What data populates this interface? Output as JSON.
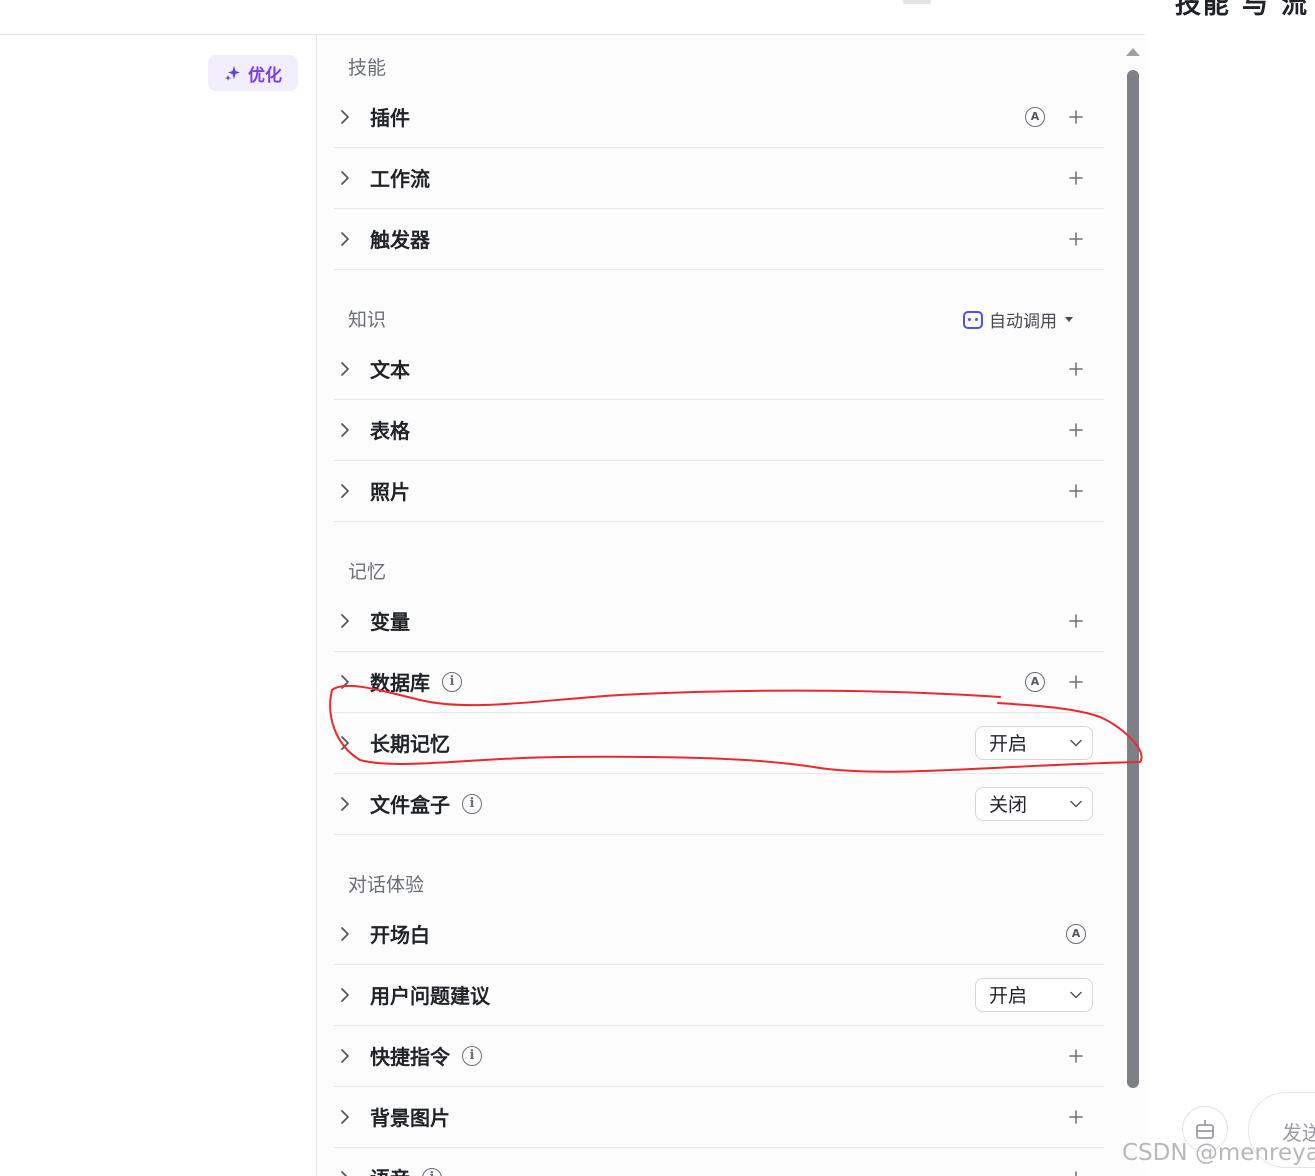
{
  "top_right_text": "技能 与 流",
  "optimize_label": "优化",
  "sections": {
    "skills": {
      "title": "技能",
      "items": [
        {
          "label": "插件",
          "auto": "A",
          "add": true
        },
        {
          "label": "工作流",
          "add": true
        },
        {
          "label": "触发器",
          "add": true
        }
      ]
    },
    "knowledge": {
      "title": "知识",
      "auto_call_label": "自动调用",
      "items": [
        {
          "label": "文本",
          "add": true
        },
        {
          "label": "表格",
          "add": true
        },
        {
          "label": "照片",
          "add": true
        }
      ]
    },
    "memory": {
      "title": "记忆",
      "items": [
        {
          "label": "变量",
          "add": true
        },
        {
          "label": "数据库",
          "info": true,
          "auto": "A",
          "add": true
        },
        {
          "label": "长期记忆",
          "select": "开启"
        },
        {
          "label": "文件盒子",
          "info": true,
          "select": "关闭"
        }
      ]
    },
    "dialog": {
      "title": "对话体验",
      "items": [
        {
          "label": "开场白",
          "auto": "A"
        },
        {
          "label": "用户问题建议",
          "select": "开启"
        },
        {
          "label": "快捷指令",
          "info": true,
          "add": true
        },
        {
          "label": "背景图片",
          "add": true
        },
        {
          "label": "语音",
          "info": true,
          "add": true
        }
      ]
    }
  },
  "info_glyph": "i",
  "send_label": "发送",
  "watermark": "CSDN @menreya",
  "colors": {
    "accent_purple": "#7b3fe4",
    "robot_blue": "#4d53e8",
    "annotation_red": "#e8292e"
  },
  "icons": [
    "sparkle-icon",
    "chevron-right-icon",
    "plus-icon",
    "auto-a-icon",
    "info-icon",
    "robot-icon",
    "chevron-down-icon",
    "debug-icon"
  ]
}
